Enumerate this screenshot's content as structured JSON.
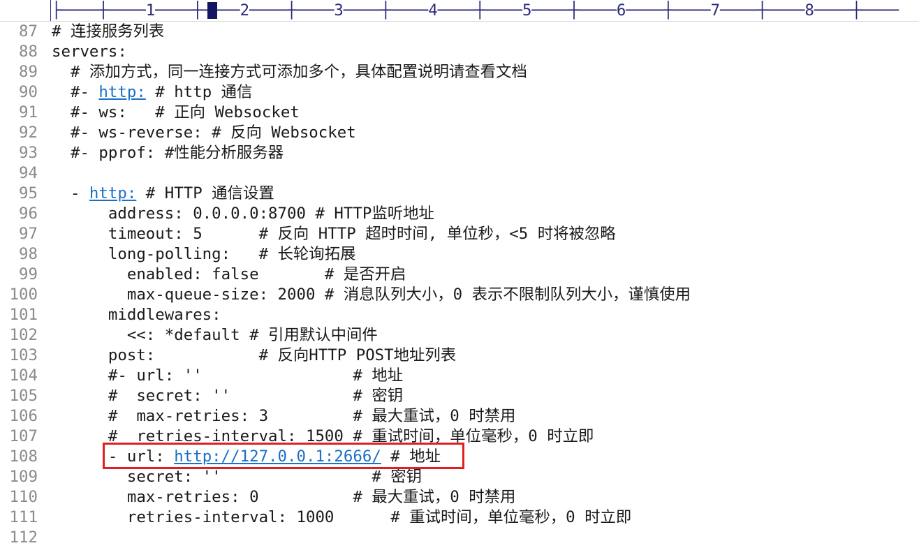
{
  "ruler": {
    "text": "├────┼────1────┼────2────┼────3────┼────4────┼────5────┼────6────┼────7────┼────8────┼────"
  },
  "colors": {
    "url": "#1a6fc6",
    "highlight": "#e02020",
    "line_number": "#8a8a8a"
  },
  "lines": [
    {
      "num": "87",
      "pre": "# 连接服务列表",
      "url": "",
      "post": ""
    },
    {
      "num": "88",
      "pre": "servers:",
      "url": "",
      "post": ""
    },
    {
      "num": "89",
      "pre": "  # 添加方式，同一连接方式可添加多个，具体配置说明请查看文档",
      "url": "",
      "post": ""
    },
    {
      "num": "90",
      "pre": "  #- ",
      "url": "http:",
      "post": " # http 通信"
    },
    {
      "num": "91",
      "pre": "  #- ws:   # 正向 Websocket",
      "url": "",
      "post": ""
    },
    {
      "num": "92",
      "pre": "  #- ws-reverse: # 反向 Websocket",
      "url": "",
      "post": ""
    },
    {
      "num": "93",
      "pre": "  #- pprof: #性能分析服务器",
      "url": "",
      "post": ""
    },
    {
      "num": "94",
      "pre": "",
      "url": "",
      "post": ""
    },
    {
      "num": "95",
      "pre": "  - ",
      "url": "http:",
      "post": " # HTTP 通信设置"
    },
    {
      "num": "96",
      "pre": "      address: 0.0.0.0:8700 # HTTP监听地址",
      "url": "",
      "post": ""
    },
    {
      "num": "97",
      "pre": "      timeout: 5      # 反向 HTTP 超时时间, 单位秒，<5 时将被忽略",
      "url": "",
      "post": ""
    },
    {
      "num": "98",
      "pre": "      long-polling:   # 长轮询拓展",
      "url": "",
      "post": ""
    },
    {
      "num": "99",
      "pre": "        enabled: false       # 是否开启",
      "url": "",
      "post": ""
    },
    {
      "num": "100",
      "pre": "        max-queue-size: 2000 # 消息队列大小，0 表示不限制队列大小，谨慎使用",
      "url": "",
      "post": ""
    },
    {
      "num": "101",
      "pre": "      middlewares:",
      "url": "",
      "post": ""
    },
    {
      "num": "102",
      "pre": "        <<: *default # 引用默认中间件",
      "url": "",
      "post": ""
    },
    {
      "num": "103",
      "pre": "      post:           # 反向HTTP POST地址列表",
      "url": "",
      "post": ""
    },
    {
      "num": "104",
      "pre": "      #- url: ''                # 地址",
      "url": "",
      "post": ""
    },
    {
      "num": "105",
      "pre": "      #  secret: ''             # 密钥",
      "url": "",
      "post": ""
    },
    {
      "num": "106",
      "pre": "      #  max-retries: 3         # 最大重试，0 时禁用",
      "url": "",
      "post": ""
    },
    {
      "num": "107",
      "pre": "      #  retries-interval: 1500 # 重试时间，单位毫秒，0 时立即",
      "url": "",
      "post": ""
    },
    {
      "num": "108",
      "pre": "      - url: ",
      "url": "http://127.0.0.1:2666/",
      "post": " # 地址"
    },
    {
      "num": "109",
      "pre": "        secret: ''                # 密钥",
      "url": "",
      "post": ""
    },
    {
      "num": "110",
      "pre": "        max-retries: 0          # 最大重试，0 时禁用",
      "url": "",
      "post": ""
    },
    {
      "num": "111",
      "pre": "        retries-interval: 1000      # 重试时间，单位毫秒，0 时立即",
      "url": "",
      "post": ""
    },
    {
      "num": "112",
      "pre": "",
      "url": "",
      "post": ""
    }
  ]
}
